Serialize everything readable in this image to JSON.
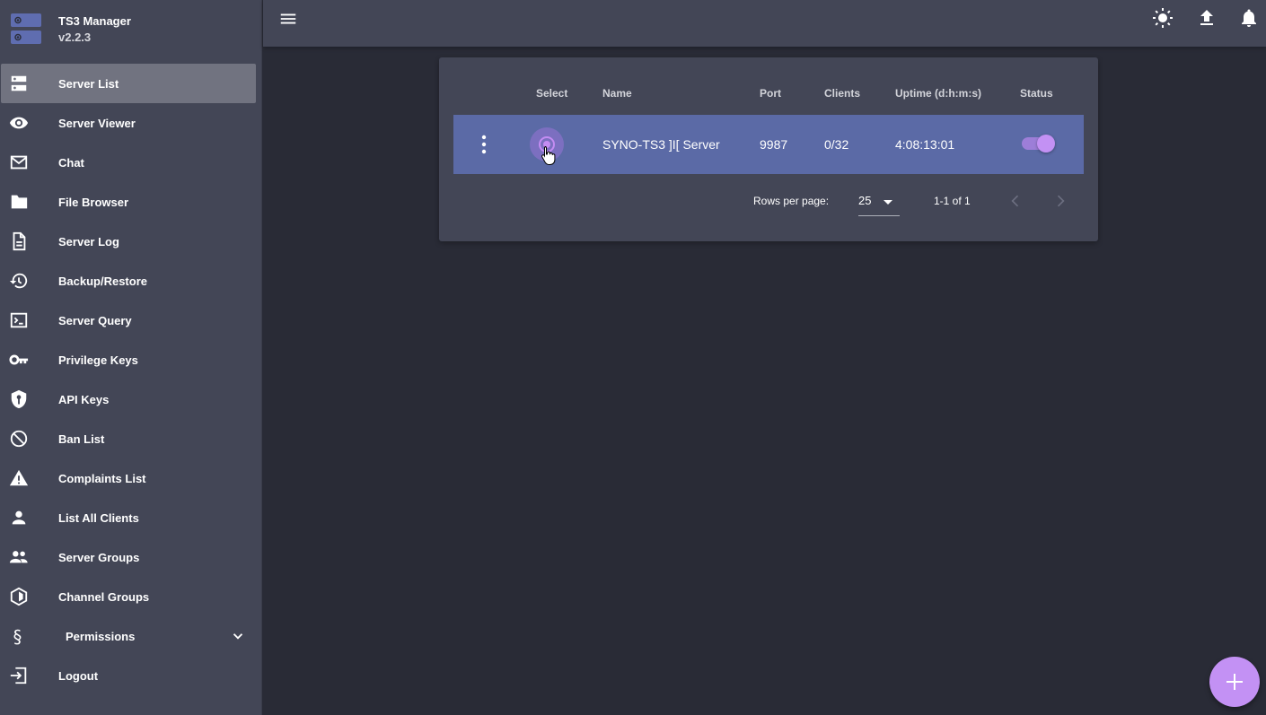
{
  "brand": {
    "title": "TS3 Manager",
    "version": "v2.2.3",
    "logo_icon": "server-stack-icon"
  },
  "sidebar": {
    "items": [
      {
        "label": "Server List",
        "icon": "dns-icon",
        "active": true
      },
      {
        "label": "Server Viewer",
        "icon": "eye-icon"
      },
      {
        "label": "Chat",
        "icon": "mail-icon"
      },
      {
        "label": "File Browser",
        "icon": "folder-icon"
      },
      {
        "label": "Server Log",
        "icon": "document-icon"
      },
      {
        "label": "Backup/Restore",
        "icon": "restore-icon"
      },
      {
        "label": "Server Query",
        "icon": "terminal-icon"
      },
      {
        "label": "Privilege Keys",
        "icon": "key-icon"
      },
      {
        "label": "API Keys",
        "icon": "shield-key-icon"
      },
      {
        "label": "Ban List",
        "icon": "block-icon"
      },
      {
        "label": "Complaints List",
        "icon": "warning-icon"
      },
      {
        "label": "List All Clients",
        "icon": "person-icon"
      },
      {
        "label": "Server Groups",
        "icon": "people-icon"
      },
      {
        "label": "Channel Groups",
        "icon": "hexagon-icon"
      },
      {
        "label": "Permissions",
        "icon": "section-sign-icon",
        "expandable": true
      },
      {
        "label": "Logout",
        "icon": "logout-icon"
      }
    ]
  },
  "topbar": {
    "icons": [
      "menu-icon",
      "brightness-icon",
      "upload-icon",
      "bell-icon"
    ]
  },
  "table": {
    "headers": {
      "select": "Select",
      "name": "Name",
      "port": "Port",
      "clients": "Clients",
      "uptime": "Uptime (d:h:m:s)",
      "status": "Status"
    },
    "rows": [
      {
        "name": "SYNO-TS3 ]I[ Server",
        "port": "9987",
        "clients": "0/32",
        "uptime": "4:08:13:01",
        "selected": true,
        "status_on": true
      }
    ],
    "footer": {
      "rows_per_page_label": "Rows per page:",
      "rows_per_page": "25",
      "range": "1-1 of 1"
    }
  },
  "colors": {
    "accent": "#c391f4",
    "row_selected": "#5b6aa6",
    "panel": "#434656",
    "background": "#292b36"
  }
}
